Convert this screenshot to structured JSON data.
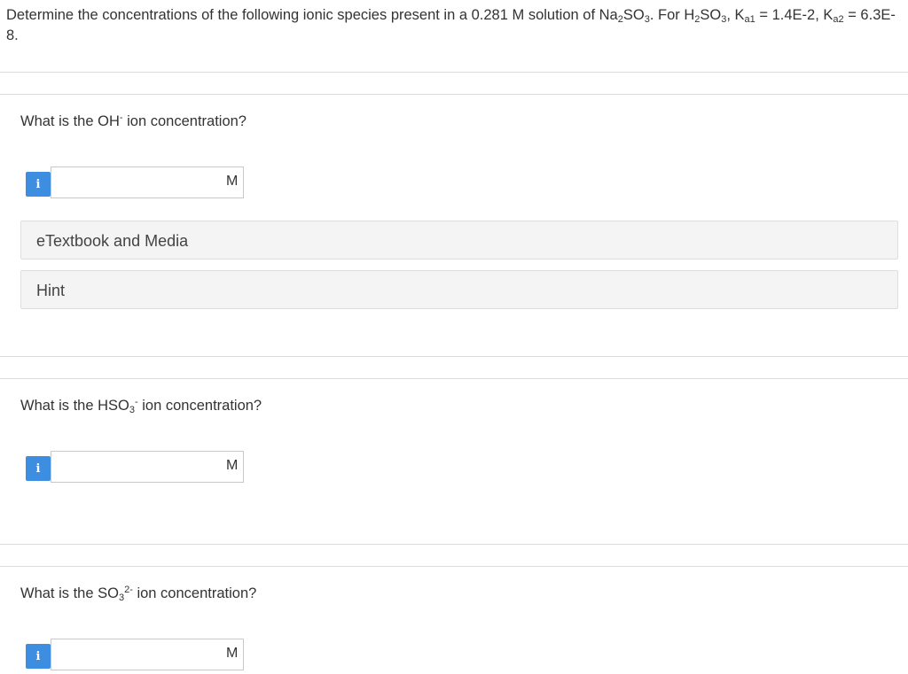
{
  "problem": {
    "t1": "Determine the concentrations of the following ionic species present in a 0.281 M solution of Na",
    "s1": "2",
    "t2": "SO",
    "s2": "3",
    "t3": ". For H",
    "s3": "2",
    "t4": "SO",
    "s4": "3",
    "t5": ", K",
    "s5": "a1",
    "t6": " = 1.4E-2, K",
    "s6": "a2",
    "t7": " = 6.3E-8."
  },
  "questions": [
    {
      "prefix": "What is the OH",
      "sub": "",
      "sup": "-",
      "suffix": " ion concentration?",
      "input_value": "",
      "unit": "M"
    },
    {
      "prefix": "What is the HSO",
      "sub": "3",
      "sup": "-",
      "suffix": " ion concentration?",
      "input_value": "",
      "unit": "M"
    },
    {
      "prefix": "What is the SO",
      "sub": "3",
      "sup": "2-",
      "suffix": " ion concentration?",
      "input_value": "",
      "unit": "M"
    }
  ],
  "info_icon_glyph": "i",
  "resources": {
    "etextbook_label": "eTextbook and Media",
    "hint_label": "Hint"
  },
  "colors": {
    "info_button": "#3d8de0",
    "resource_bg": "#f4f4f4",
    "divider": "#dcdcdc"
  }
}
